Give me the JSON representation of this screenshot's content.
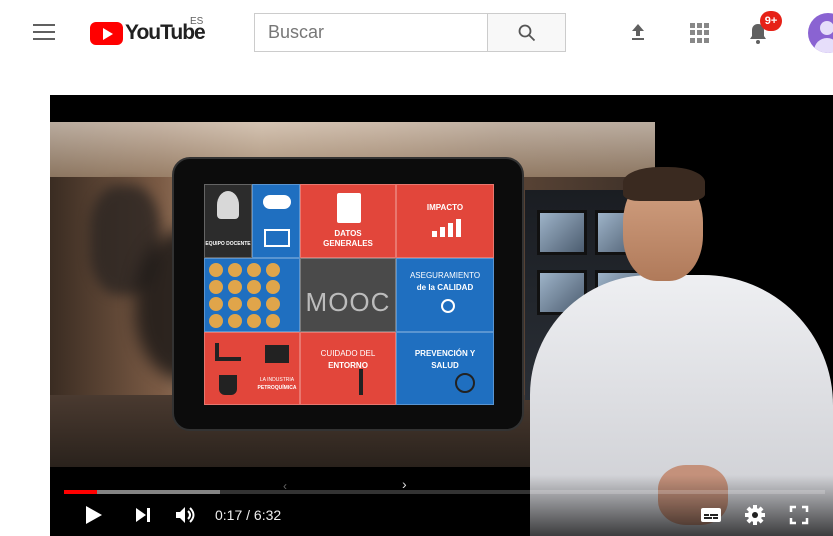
{
  "masthead": {
    "logo_text": "YouTube",
    "country_code": "ES",
    "search_placeholder": "Buscar",
    "notification_count": "9+",
    "icons": {
      "menu": "menu-icon",
      "search": "search-icon",
      "upload": "upload-icon",
      "apps": "apps-grid-icon",
      "notifications": "bell-icon",
      "account": "avatar-icon"
    }
  },
  "video": {
    "tablet_tiles": {
      "equipo_docente": "EQUIPO DOCENTE",
      "datos_generales": "DATOS GENERALES",
      "impacto": "IMPACTO",
      "mooc": "MOOC",
      "aseguramiento_line1": "ASEGURAMIENTO",
      "aseguramiento_line2": "de la CALIDAD",
      "cuidado_line1": "CUIDADO DEL",
      "cuidado_line2": "ENTORNO",
      "prevencion_line1": "PREVENCIÓN Y",
      "prevencion_line2": "SALUD",
      "industria_line1": "LA INDUSTRIA",
      "industria_line2": "PETROQUÍMICA"
    }
  },
  "player_controls": {
    "current_time": "0:17",
    "duration": "6:32",
    "time_display": "0:17 / 6:32",
    "progress_fraction": 0.043,
    "buffer_fraction": 0.205,
    "progress_color": "#ff0000",
    "icons": {
      "play": "play-icon",
      "next": "next-icon",
      "volume": "volume-icon",
      "subtitles": "subtitles-icon",
      "settings": "gear-icon",
      "fullscreen": "fullscreen-icon"
    }
  }
}
